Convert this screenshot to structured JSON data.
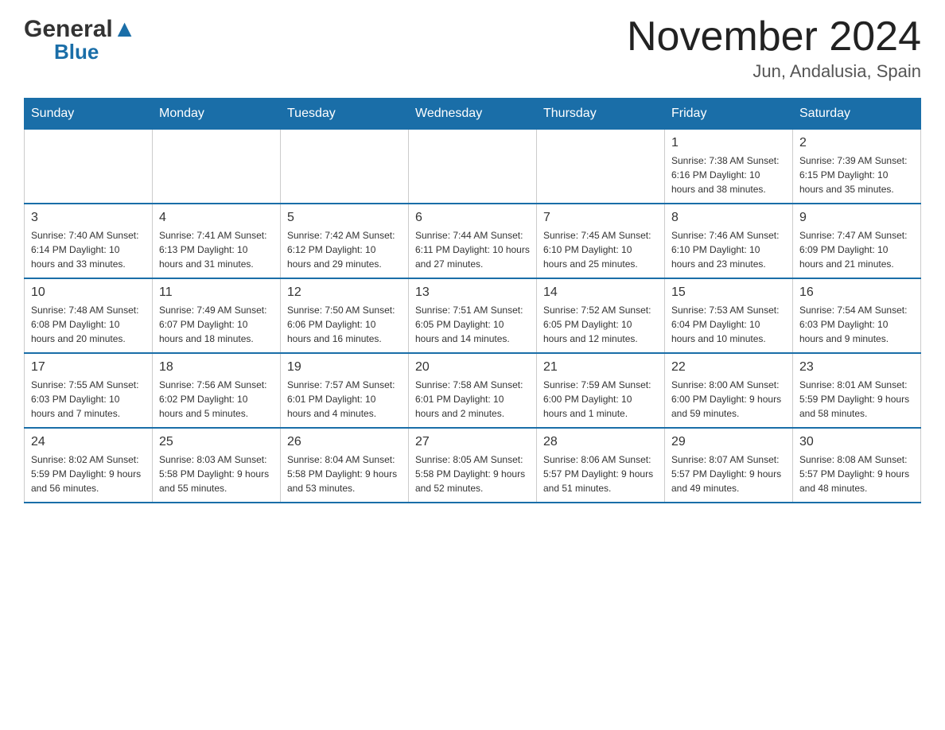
{
  "header": {
    "logo_general": "General",
    "logo_blue": "Blue",
    "month_year": "November 2024",
    "location": "Jun, Andalusia, Spain"
  },
  "days_of_week": [
    "Sunday",
    "Monday",
    "Tuesday",
    "Wednesday",
    "Thursday",
    "Friday",
    "Saturday"
  ],
  "weeks": [
    [
      {
        "day": "",
        "info": ""
      },
      {
        "day": "",
        "info": ""
      },
      {
        "day": "",
        "info": ""
      },
      {
        "day": "",
        "info": ""
      },
      {
        "day": "",
        "info": ""
      },
      {
        "day": "1",
        "info": "Sunrise: 7:38 AM\nSunset: 6:16 PM\nDaylight: 10 hours and 38 minutes."
      },
      {
        "day": "2",
        "info": "Sunrise: 7:39 AM\nSunset: 6:15 PM\nDaylight: 10 hours and 35 minutes."
      }
    ],
    [
      {
        "day": "3",
        "info": "Sunrise: 7:40 AM\nSunset: 6:14 PM\nDaylight: 10 hours and 33 minutes."
      },
      {
        "day": "4",
        "info": "Sunrise: 7:41 AM\nSunset: 6:13 PM\nDaylight: 10 hours and 31 minutes."
      },
      {
        "day": "5",
        "info": "Sunrise: 7:42 AM\nSunset: 6:12 PM\nDaylight: 10 hours and 29 minutes."
      },
      {
        "day": "6",
        "info": "Sunrise: 7:44 AM\nSunset: 6:11 PM\nDaylight: 10 hours and 27 minutes."
      },
      {
        "day": "7",
        "info": "Sunrise: 7:45 AM\nSunset: 6:10 PM\nDaylight: 10 hours and 25 minutes."
      },
      {
        "day": "8",
        "info": "Sunrise: 7:46 AM\nSunset: 6:10 PM\nDaylight: 10 hours and 23 minutes."
      },
      {
        "day": "9",
        "info": "Sunrise: 7:47 AM\nSunset: 6:09 PM\nDaylight: 10 hours and 21 minutes."
      }
    ],
    [
      {
        "day": "10",
        "info": "Sunrise: 7:48 AM\nSunset: 6:08 PM\nDaylight: 10 hours and 20 minutes."
      },
      {
        "day": "11",
        "info": "Sunrise: 7:49 AM\nSunset: 6:07 PM\nDaylight: 10 hours and 18 minutes."
      },
      {
        "day": "12",
        "info": "Sunrise: 7:50 AM\nSunset: 6:06 PM\nDaylight: 10 hours and 16 minutes."
      },
      {
        "day": "13",
        "info": "Sunrise: 7:51 AM\nSunset: 6:05 PM\nDaylight: 10 hours and 14 minutes."
      },
      {
        "day": "14",
        "info": "Sunrise: 7:52 AM\nSunset: 6:05 PM\nDaylight: 10 hours and 12 minutes."
      },
      {
        "day": "15",
        "info": "Sunrise: 7:53 AM\nSunset: 6:04 PM\nDaylight: 10 hours and 10 minutes."
      },
      {
        "day": "16",
        "info": "Sunrise: 7:54 AM\nSunset: 6:03 PM\nDaylight: 10 hours and 9 minutes."
      }
    ],
    [
      {
        "day": "17",
        "info": "Sunrise: 7:55 AM\nSunset: 6:03 PM\nDaylight: 10 hours and 7 minutes."
      },
      {
        "day": "18",
        "info": "Sunrise: 7:56 AM\nSunset: 6:02 PM\nDaylight: 10 hours and 5 minutes."
      },
      {
        "day": "19",
        "info": "Sunrise: 7:57 AM\nSunset: 6:01 PM\nDaylight: 10 hours and 4 minutes."
      },
      {
        "day": "20",
        "info": "Sunrise: 7:58 AM\nSunset: 6:01 PM\nDaylight: 10 hours and 2 minutes."
      },
      {
        "day": "21",
        "info": "Sunrise: 7:59 AM\nSunset: 6:00 PM\nDaylight: 10 hours and 1 minute."
      },
      {
        "day": "22",
        "info": "Sunrise: 8:00 AM\nSunset: 6:00 PM\nDaylight: 9 hours and 59 minutes."
      },
      {
        "day": "23",
        "info": "Sunrise: 8:01 AM\nSunset: 5:59 PM\nDaylight: 9 hours and 58 minutes."
      }
    ],
    [
      {
        "day": "24",
        "info": "Sunrise: 8:02 AM\nSunset: 5:59 PM\nDaylight: 9 hours and 56 minutes."
      },
      {
        "day": "25",
        "info": "Sunrise: 8:03 AM\nSunset: 5:58 PM\nDaylight: 9 hours and 55 minutes."
      },
      {
        "day": "26",
        "info": "Sunrise: 8:04 AM\nSunset: 5:58 PM\nDaylight: 9 hours and 53 minutes."
      },
      {
        "day": "27",
        "info": "Sunrise: 8:05 AM\nSunset: 5:58 PM\nDaylight: 9 hours and 52 minutes."
      },
      {
        "day": "28",
        "info": "Sunrise: 8:06 AM\nSunset: 5:57 PM\nDaylight: 9 hours and 51 minutes."
      },
      {
        "day": "29",
        "info": "Sunrise: 8:07 AM\nSunset: 5:57 PM\nDaylight: 9 hours and 49 minutes."
      },
      {
        "day": "30",
        "info": "Sunrise: 8:08 AM\nSunset: 5:57 PM\nDaylight: 9 hours and 48 minutes."
      }
    ]
  ]
}
